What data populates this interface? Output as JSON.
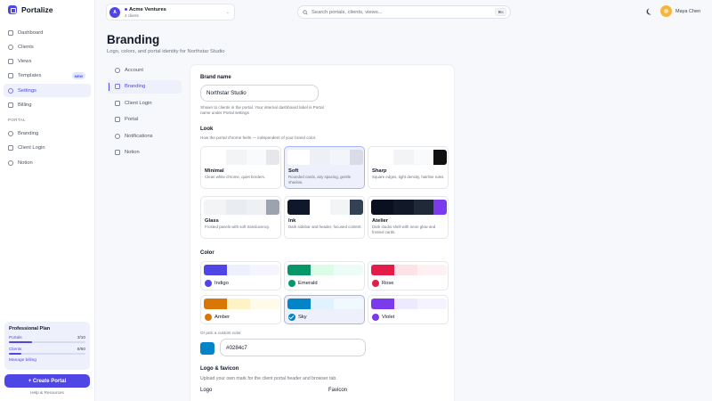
{
  "app": {
    "name": "Portalize"
  },
  "sidebar": {
    "items": [
      {
        "label": "Dashboard"
      },
      {
        "label": "Clients"
      },
      {
        "label": "Views"
      },
      {
        "label": "Templates",
        "badge": "NEW"
      },
      {
        "label": "Settings"
      },
      {
        "label": "Billing"
      }
    ],
    "section_label": "PORTAL",
    "portal_items": [
      {
        "label": "Branding"
      },
      {
        "label": "Client Login"
      },
      {
        "label": "Notion"
      }
    ],
    "plan": {
      "title": "Professional Plan",
      "portals_label": "Portals",
      "portals_value": "3/10",
      "portals_fraction": 0.3,
      "clients_label": "Clients",
      "clients_value": "8/50",
      "clients_fraction": 0.16,
      "manage_label": "Manage billing"
    },
    "create_label": "+ Create Portal",
    "help_label": "Help & Resources"
  },
  "topbar": {
    "workspace": {
      "avatar": "A",
      "name": "Acme Ventures",
      "sub": "4 clients"
    },
    "search": {
      "placeholder": "Search portals, clients, views...",
      "shortcut": "⌘K"
    },
    "user": {
      "name": "Maya Chen"
    }
  },
  "page": {
    "title": "Branding",
    "subtitle": "Logo, colors, and portal identity for Northstar Studio"
  },
  "subnav": {
    "items": [
      {
        "label": "Account"
      },
      {
        "label": "Branding"
      },
      {
        "label": "Client Login"
      },
      {
        "label": "Portal"
      },
      {
        "label": "Notifications"
      },
      {
        "label": "Notion"
      }
    ]
  },
  "form": {
    "brand_name_label": "Brand name",
    "brand_name_value": "Northstar Studio",
    "brand_name_hint": "Shown to clients in the portal. Your internal dashboard label is Portal name under Portal settings",
    "look_label": "Look",
    "look_hint": "How the portal chrome feels — independent of your brand color.",
    "looks": [
      {
        "name": "Minimal",
        "desc": "Clean white chrome, quiet borders.",
        "colors": [
          "#ffffff",
          "#f3f4f6",
          "#f9fafb",
          "#e5e7eb"
        ]
      },
      {
        "name": "Soft",
        "desc": "Rounded cards, airy spacing, gentle shadow.",
        "colors": [
          "#ffffff",
          "#eef0f6",
          "#f4f5fa",
          "#d9dce6"
        ]
      },
      {
        "name": "Sharp",
        "desc": "Square edges, tight density, hairline rules.",
        "colors": [
          "#ffffff",
          "#f3f4f6",
          "#f9fafb",
          "#111111"
        ]
      },
      {
        "name": "Glass",
        "desc": "Frosted panels with soft translucency.",
        "colors": [
          "#f3f4f6",
          "#e9ecf1",
          "#eef0f3",
          "#9ca3af"
        ]
      },
      {
        "name": "Ink",
        "desc": "Dark sidebar and header, focused content.",
        "colors": [
          "#0f172a",
          "#ffffff",
          "#f3f4f6",
          "#334155"
        ]
      },
      {
        "name": "Atelier",
        "desc": "Dark studio shell with neon glow and frosted cards.",
        "colors": [
          "#0b1020",
          "#111827",
          "#1f2937",
          "#7c3aed"
        ]
      }
    ],
    "color_label": "Color",
    "colors": [
      {
        "name": "Indigo",
        "hex": "#4f46e5",
        "light": "#eef0fe",
        "lighter": "#f4f5ff"
      },
      {
        "name": "Emerald",
        "hex": "#059669",
        "light": "#dcfce7",
        "lighter": "#ecfdf5"
      },
      {
        "name": "Rose",
        "hex": "#e11d48",
        "light": "#fde2e7",
        "lighter": "#fff1f3"
      },
      {
        "name": "Amber",
        "hex": "#d97706",
        "light": "#fef3c7",
        "lighter": "#fffbeb"
      },
      {
        "name": "Sky",
        "hex": "#0284c7",
        "light": "#e0f2fe",
        "lighter": "#f0f9ff"
      },
      {
        "name": "Violet",
        "hex": "#7c3aed",
        "light": "#ede9fe",
        "lighter": "#f5f3ff"
      }
    ],
    "selected_look": "Soft",
    "selected_color": "Sky",
    "custom_color_label": "Or pick a custom color",
    "custom_color_value": "#0284c7",
    "logo_section_label": "Logo & favicon",
    "logo_section_hint": "Upload your own mark for the client portal header and browser tab.",
    "logo_label": "Logo",
    "favicon_label": "Favicon"
  }
}
